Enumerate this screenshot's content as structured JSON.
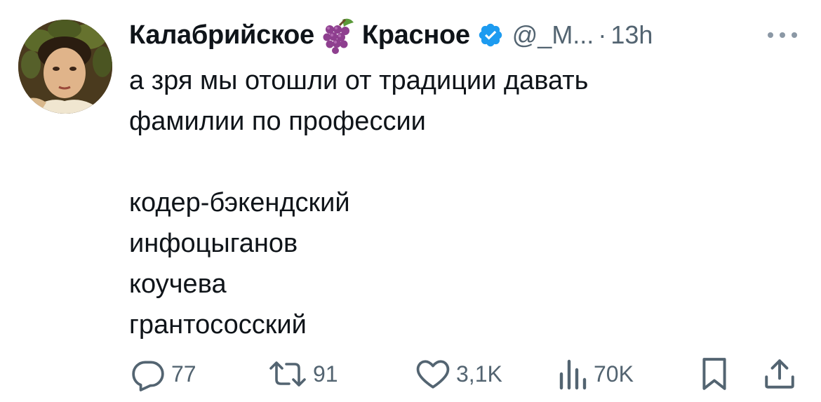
{
  "tweet": {
    "author": {
      "display_name_part1": "Калабрийское",
      "display_name_emoji": "grapes-emoji",
      "display_name_part2": "Красное",
      "verified_icon": "verified-badge-icon",
      "handle": "@_M...",
      "separator": "·",
      "time": "13h"
    },
    "text": "а зря мы отошли от традиции давать\nфамилии по профессии\n\nкодер-бэкендский\nинфоцыганов\nкоучева\nгрантососский",
    "actions": {
      "replies": "77",
      "reposts": "91",
      "likes": "3,1K",
      "views": "70K"
    }
  },
  "colors": {
    "text_primary": "#0f1419",
    "text_secondary": "#536471",
    "verified_blue": "#1d9bf0",
    "grapes": "#8e3f8f"
  }
}
